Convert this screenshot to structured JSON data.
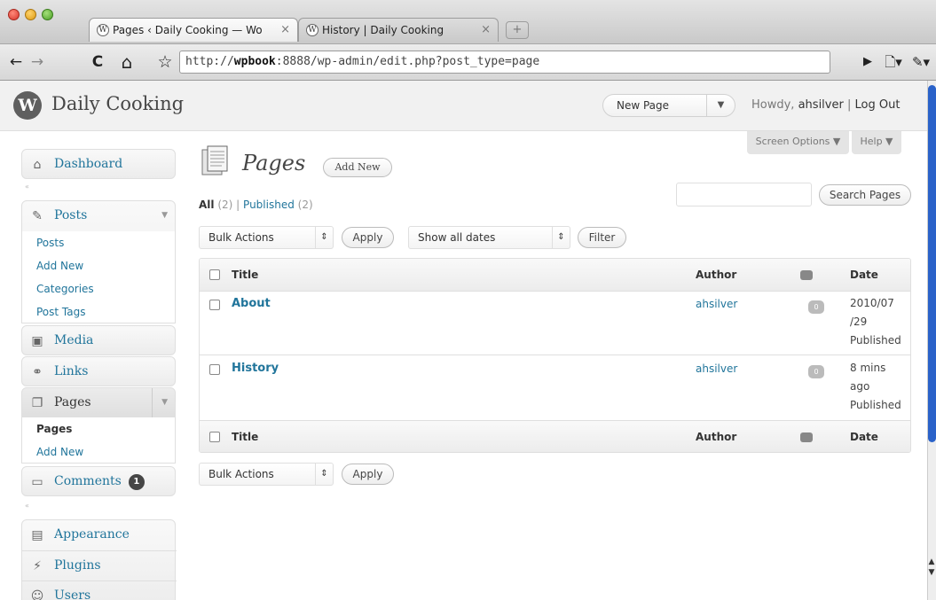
{
  "browser": {
    "tabs": [
      {
        "label": "Pages ‹ Daily Cooking — Wo",
        "close": "×",
        "active": true
      },
      {
        "label": "History | Daily Cooking",
        "close": "×",
        "active": false
      }
    ],
    "new_tab_icon": "+",
    "url_prefix": "http://",
    "url_host": "wpbook",
    "url_rest": ":8888/wp-admin/edit.php?post_type=page",
    "nav": {
      "back": "←",
      "forward": "→",
      "reload": "C",
      "home": "⌂",
      "star": "☆",
      "go": "▶",
      "page": "🗋▾",
      "wrench": "✎▾"
    }
  },
  "wp_header": {
    "logo_letter": "W",
    "site_name": "Daily Cooking",
    "new_page_label": "New Page",
    "dropdown_arrow": "▼",
    "howdy_prefix": "Howdy,",
    "user": "ahsilver",
    "separator": "|",
    "logout": "Log Out"
  },
  "sidebar": {
    "dashboard": "Dashboard",
    "posts": {
      "label": "Posts",
      "items": [
        "Posts",
        "Add New",
        "Categories",
        "Post Tags"
      ]
    },
    "media": "Media",
    "links": "Links",
    "pages": {
      "label": "Pages",
      "items": [
        "Pages",
        "Add New"
      ]
    },
    "comments": {
      "label": "Comments",
      "count": "1"
    },
    "appearance": "Appearance",
    "plugins": "Plugins",
    "users": "Users",
    "collapse_arrow": "«",
    "toggle": "▼"
  },
  "main": {
    "screen_options": "Screen Options ▼",
    "help": "Help ▼",
    "title": "Pages",
    "add_new": "Add New",
    "filters": {
      "all": "All",
      "all_count": "(2)",
      "sep": "|",
      "published": "Published",
      "published_count": "(2)"
    },
    "search_button": "Search Pages",
    "bulk_actions": "Bulk Actions",
    "apply": "Apply",
    "dates": "Show all dates",
    "filter": "Filter",
    "columns": {
      "title": "Title",
      "author": "Author",
      "date": "Date"
    },
    "rows": [
      {
        "title": "About",
        "author": "ahsilver",
        "comments": "0",
        "date_line1": "2010/07",
        "date_line2": "/29",
        "status": "Published"
      },
      {
        "title": "History",
        "author": "ahsilver",
        "comments": "0",
        "date_line1": "8 mins",
        "date_line2": "ago",
        "status": "Published"
      }
    ]
  },
  "colors": {
    "link": "#21759b",
    "header_bg": "#f1f1f1",
    "scrollbar": "#2a62c9"
  }
}
